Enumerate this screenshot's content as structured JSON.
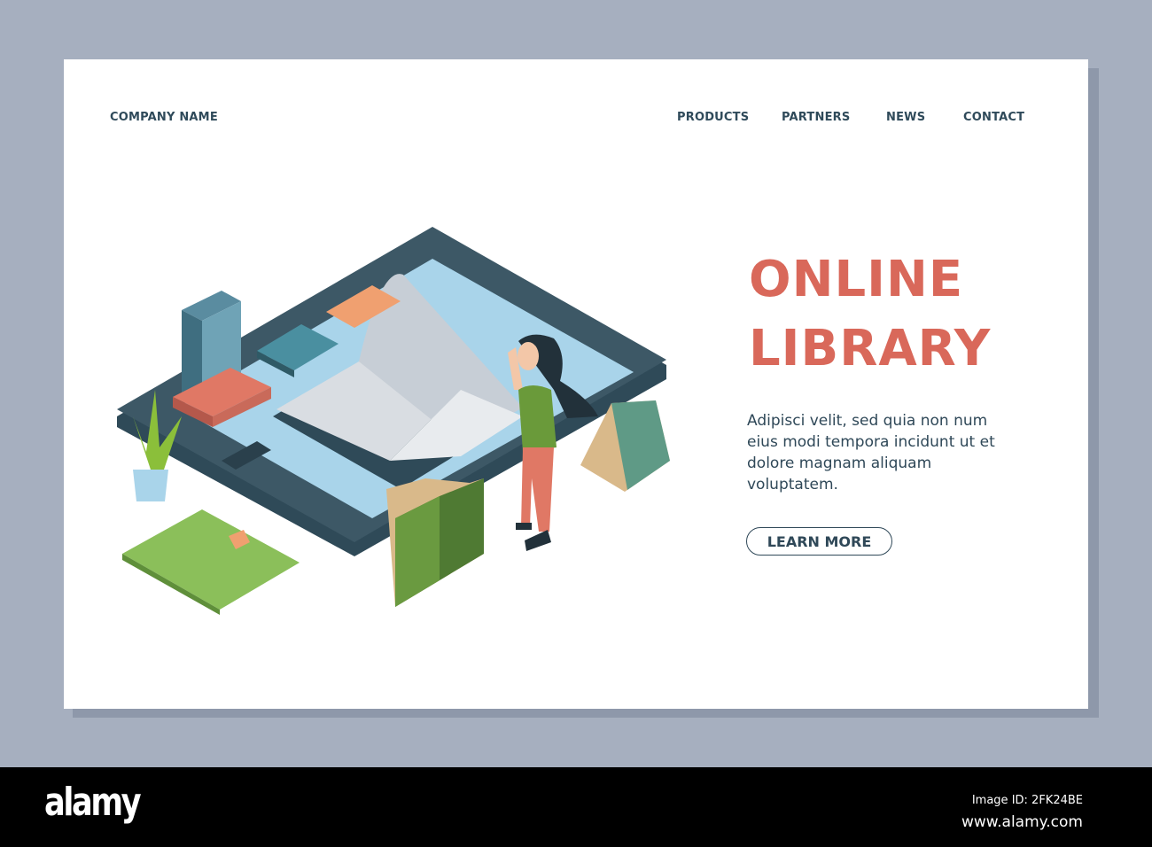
{
  "header": {
    "company_name": "COMPANY NAME",
    "nav": [
      "PRODUCTS",
      "PARTNERS",
      "NEWS",
      "CONTACT"
    ]
  },
  "hero": {
    "title_line1": "ONLINE",
    "title_line2": "LIBRARY",
    "body": "Adipisci velit, sed quia non num eius modi tempora incidunt ut et dolore magnam aliquam voluptatem.",
    "cta": "LEARN MORE"
  },
  "footer": {
    "logo": "alamy",
    "image_id": "Image ID: 2FK24BE",
    "url": "www.alamy.com"
  },
  "colors": {
    "accent": "#d9685a",
    "text": "#2f4858",
    "background": "#a6afbf"
  }
}
